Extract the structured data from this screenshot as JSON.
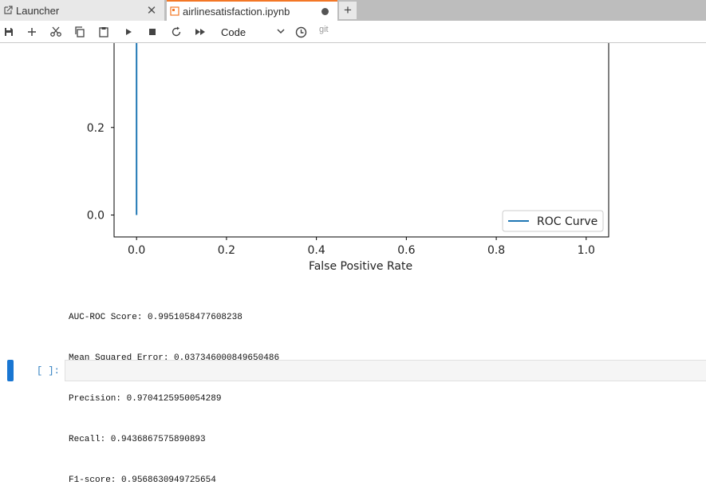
{
  "tabs": [
    {
      "label": "Launcher",
      "active": false,
      "icon": "launcher-icon"
    },
    {
      "label": "airlinesatisfaction.ipynb",
      "active": true,
      "icon": "notebook-icon",
      "dirty": true
    }
  ],
  "toolbar": {
    "buttons": [
      "save-icon",
      "add-cell-icon",
      "cut-icon",
      "copy-icon",
      "paste-icon",
      "run-icon",
      "stop-icon",
      "restart-icon",
      "fast-forward-icon"
    ],
    "cell_type": "Code",
    "git_label": "git"
  },
  "colors": {
    "accent": "#f37726",
    "line": "#1f77b4",
    "active_cell": "#1976d2",
    "prompt": "#307fc1"
  },
  "chart_data": {
    "type": "line",
    "xlabel": "False Positive Rate",
    "xticks": [
      "0.0",
      "0.2",
      "0.4",
      "0.6",
      "0.8",
      "1.0"
    ],
    "yticks": [
      "0.0",
      "0.2"
    ],
    "xlim": [
      -0.05,
      1.05
    ],
    "ylim": [
      -0.05,
      0.4
    ],
    "grid": false,
    "legend_position": "lower-right",
    "series": [
      {
        "name": "ROC Curve",
        "x": [
          0.0,
          0.0
        ],
        "y": [
          0.0,
          0.4
        ]
      }
    ]
  },
  "output_lines": [
    "AUC-ROC Score: 0.9951058477608238",
    "Mean Squared Error: 0.037346000849650486",
    "Precision: 0.9704125950054289",
    "Recall: 0.9436867575890893",
    "F1-score: 0.9568630949725654"
  ],
  "next_cell": {
    "prompt": "[ ]:",
    "content": ""
  }
}
